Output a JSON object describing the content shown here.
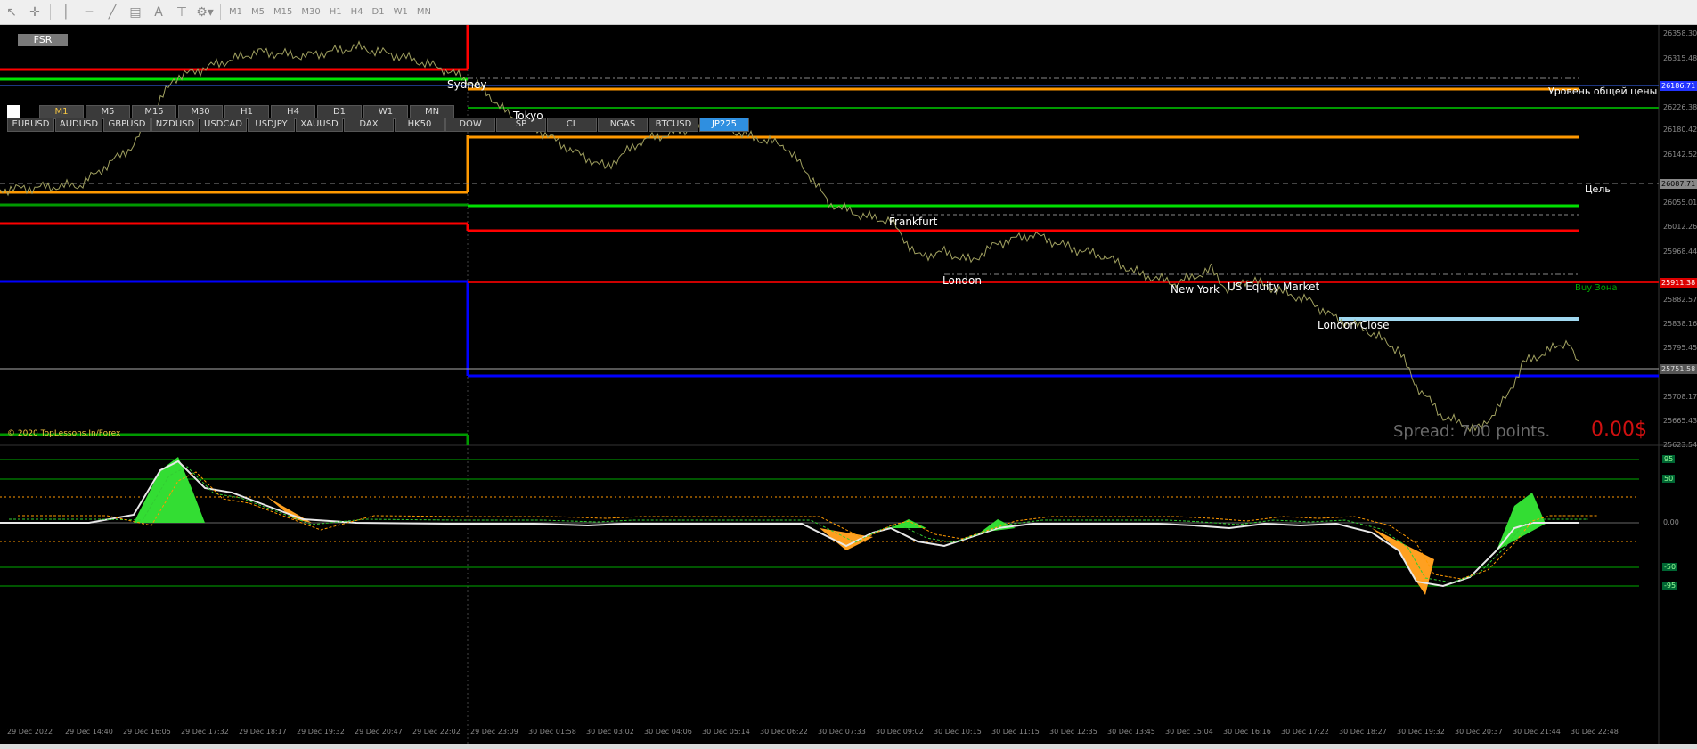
{
  "toolbar": {
    "timeframes": [
      "M1",
      "M5",
      "M15",
      "M30",
      "H1",
      "H4",
      "D1",
      "W1",
      "MN"
    ]
  },
  "chart": {
    "fsr_label": "FSR",
    "tf_buttons": [
      "M1",
      "M5",
      "M15",
      "M30",
      "H1",
      "H4",
      "D1",
      "W1",
      "MN"
    ],
    "active_tf": "M1",
    "symbols": [
      "EURUSD",
      "AUDUSD",
      "GBPUSD",
      "NZDUSD",
      "USDCAD",
      "USDJPY",
      "XAUUSD",
      "DAX",
      "HK50",
      "DOW",
      "SP",
      "CL",
      "NGAS",
      "BTCUSD",
      "JP225"
    ],
    "active_symbol": "JP225",
    "sessions": {
      "sydney": "Sydney",
      "tokyo": "Tokyo",
      "frankfurt": "Frankfurt",
      "london": "London",
      "new_york": "New York",
      "us_equity": "US Equity Market",
      "london_close": "London Close"
    },
    "labels": {
      "general_price_level": "Уровень общей цены",
      "target": "Цель",
      "buy_zone": "Buy Зона",
      "spread": "Spread: 700 points.",
      "profit": "0.00$",
      "copyright": "© 2020 TopLessons.In/Forex"
    },
    "price_axis": [
      "26358.30",
      "26315.48",
      "26270.72",
      "26226.38",
      "26180.42",
      "26142.52",
      "26098.45",
      "26055.01",
      "26012.26",
      "25968.44",
      "25922.71",
      "25882.57",
      "25838.16",
      "25795.45",
      "25750.87",
      "25708.17",
      "25665.43",
      "25623.54"
    ],
    "price_tags": {
      "blue": "26186.71",
      "grey": "26087.71",
      "red": "25911.38",
      "current": "25751.58"
    },
    "time_axis": [
      "29 Dec 2022",
      "29 Dec 14:40",
      "29 Dec 16:05",
      "29 Dec 17:32",
      "29 Dec 18:17",
      "29 Dec 19:32",
      "29 Dec 20:47",
      "29 Dec 22:02",
      "29 Dec 23:09",
      "30 Dec 01:58",
      "30 Dec 03:02",
      "30 Dec 04:06",
      "30 Dec 05:14",
      "30 Dec 06:22",
      "30 Dec 07:33",
      "30 Dec 09:02",
      "30 Dec 10:15",
      "30 Dec 11:15",
      "30 Dec 12:35",
      "30 Dec 13:45",
      "30 Dec 15:04",
      "30 Dec 16:16",
      "30 Dec 17:22",
      "30 Dec 18:27",
      "30 Dec 19:32",
      "30 Dec 20:37",
      "30 Dec 21:44",
      "30 Dec 22:48"
    ],
    "indicator": {
      "levels": [
        "95",
        "50",
        "0.00",
        "-50",
        "-95"
      ]
    },
    "colors": {
      "red": "#ff0000",
      "green": "#00e000",
      "orange": "#ff9900",
      "blue": "#0000ff",
      "price": "#a0a060",
      "lightblue": "#a0d8f0"
    }
  }
}
